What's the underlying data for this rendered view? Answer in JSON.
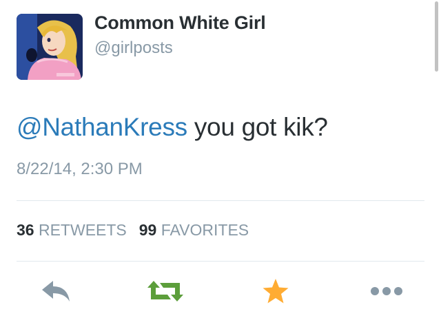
{
  "user": {
    "display_name": "Common White Girl",
    "handle": "@girlposts",
    "avatar_icon": "cartoon-princess-avatar"
  },
  "tweet": {
    "mention": "@NathanKress",
    "text": " you got kik?",
    "timestamp": "8/22/14, 2:30 PM"
  },
  "stats": {
    "retweets_count": "36",
    "retweets_label": "RETWEETS",
    "favorites_count": "99",
    "favorites_label": "FAVORITES"
  },
  "actions": [
    {
      "icon": "reply-icon",
      "color": "#8899a6"
    },
    {
      "icon": "retweet-icon",
      "color": "#5c9e3b"
    },
    {
      "icon": "favorite-star-icon",
      "color": "#ffac33"
    },
    {
      "icon": "more-icon",
      "color": "#8899a6"
    }
  ],
  "colors": {
    "text": "#292f33",
    "muted": "#8899a6",
    "link": "#2b7bb9",
    "divider": "#e1e8ed"
  }
}
